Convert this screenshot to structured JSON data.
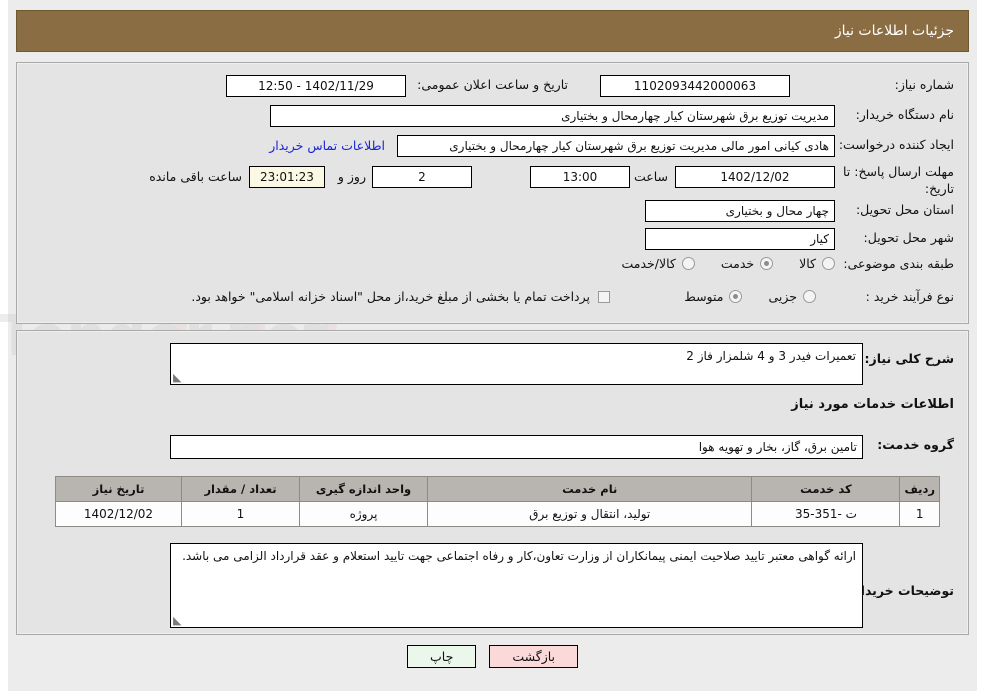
{
  "header": {
    "title": "جزئیات اطلاعات نیاز"
  },
  "top_panel": {
    "need_number_label": "شماره نیاز:",
    "need_number_value": "1102093442000063",
    "announce_label": "تاریخ و ساعت اعلان عمومی:",
    "announce_value": "1402/11/29 - 12:50",
    "buyer_org_label": "نام دستگاه خریدار:",
    "buyer_org_value": "مدیریت توزیع برق شهرستان کیار چهارمحال و بختیاری",
    "requester_label": "ایجاد کننده درخواست:",
    "requester_value": "هادی کیانی امور مالی مدیریت توزیع برق شهرستان کیار چهارمحال و بختیاری",
    "contact_link": "اطلاعات تماس خریدار",
    "deadline_label": "مهلت ارسال پاسخ: تا تاریخ:",
    "deadline_date": "1402/12/02",
    "deadline_hour_label": "ساعت",
    "deadline_hour_value": "13:00",
    "remaining_days_value": "2",
    "remaining_days_label": "روز و",
    "remaining_time_value": "23:01:23",
    "remaining_time_label": "ساعت باقی مانده",
    "province_label": "استان محل تحویل:",
    "province_value": "چهار محال و بختیاری",
    "city_label": "شهر محل تحویل:",
    "city_value": "کیار",
    "category_label": "طبقه بندی موضوعی:",
    "category_options": [
      {
        "label": "کالا",
        "selected": false
      },
      {
        "label": "خدمت",
        "selected": true
      },
      {
        "label": "کالا/خدمت",
        "selected": false
      }
    ],
    "process_label": "نوع فرآیند خرید :",
    "process_options": [
      {
        "label": "جزیی",
        "selected": false
      },
      {
        "label": "متوسط",
        "selected": true
      }
    ],
    "treasury_checkbox_label": "پرداخت تمام یا بخشی از مبلغ خرید،از محل \"اسناد خزانه اسلامی\" خواهد بود.",
    "treasury_checked": false
  },
  "mid_panel": {
    "general_desc_label": "شرح کلی نیاز:",
    "general_desc_value": "تعمیرات فیدر 3 و 4 شلمزار فاز 2",
    "services_heading": "اطلاعات خدمات مورد نیاز",
    "service_group_label": "گروه خدمت:",
    "service_group_value": "تامین برق، گاز، بخار و تهویه هوا",
    "table": {
      "headers": [
        "ردیف",
        "کد خدمت",
        "نام خدمت",
        "واحد اندازه گیری",
        "تعداد / مقدار",
        "تاریخ نیاز"
      ],
      "rows": [
        {
          "row_no": "1",
          "service_code": "ت -351-35",
          "service_name": "تولید، انتقال و توزیع برق",
          "unit": "پروژه",
          "quantity": "1",
          "need_date": "1402/12/02"
        }
      ]
    },
    "buyer_notes_label": "توضیحات خریدار:",
    "buyer_notes_value": "ارائه گواهی معتبر تایید صلاحیت ایمنی پیمانکاران از وزارت تعاون،کار و رفاه اجتماعی جهت تایید استعلام و عقد قرارداد الزامی می باشد."
  },
  "footer": {
    "print_label": "چاپ",
    "back_label": "بازگشت"
  },
  "watermark": {
    "text": "AriaTender.net"
  },
  "colors": {
    "header_bg": "#8a6d42",
    "panel_bg": "#e4e4e4",
    "link": "#1a25d8",
    "table_header_bg": "#b8b5b1",
    "print_btn": "#eaf7ea",
    "back_btn": "#fbd9d9",
    "countdown_bg": "#fbf8e3"
  }
}
